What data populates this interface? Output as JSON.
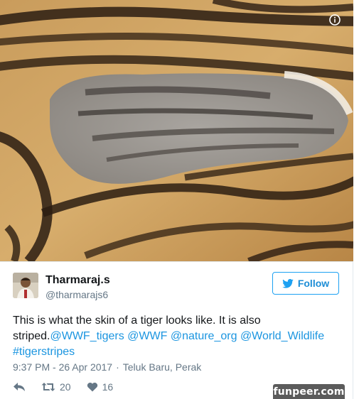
{
  "tweet": {
    "display_name": "Tharmaraj.s",
    "handle": "@tharmarajs6",
    "follow_label": "Follow",
    "text_prefix": "This is what the skin of a tiger looks like. It is also striped.",
    "links": [
      "@WWF_tigers",
      "@WWF",
      "@nature_org",
      "@World_Wildlife",
      "#tigerstripes"
    ],
    "time": "9:37 PM - 26 Apr 2017",
    "separator": "·",
    "location": "Teluk Baru, Perak",
    "retweet_count": "20",
    "like_count": "16"
  },
  "icons": {
    "info": "info-icon",
    "twitter_bird": "twitter-bird-icon",
    "reply": "reply-icon",
    "retweet": "retweet-icon",
    "like": "heart-icon"
  },
  "colors": {
    "link": "#1b95e0",
    "follow_border": "#1da1f2",
    "muted": "#657786",
    "watermark_bg": "#5b5b5b"
  },
  "watermark": "funpeer.com"
}
